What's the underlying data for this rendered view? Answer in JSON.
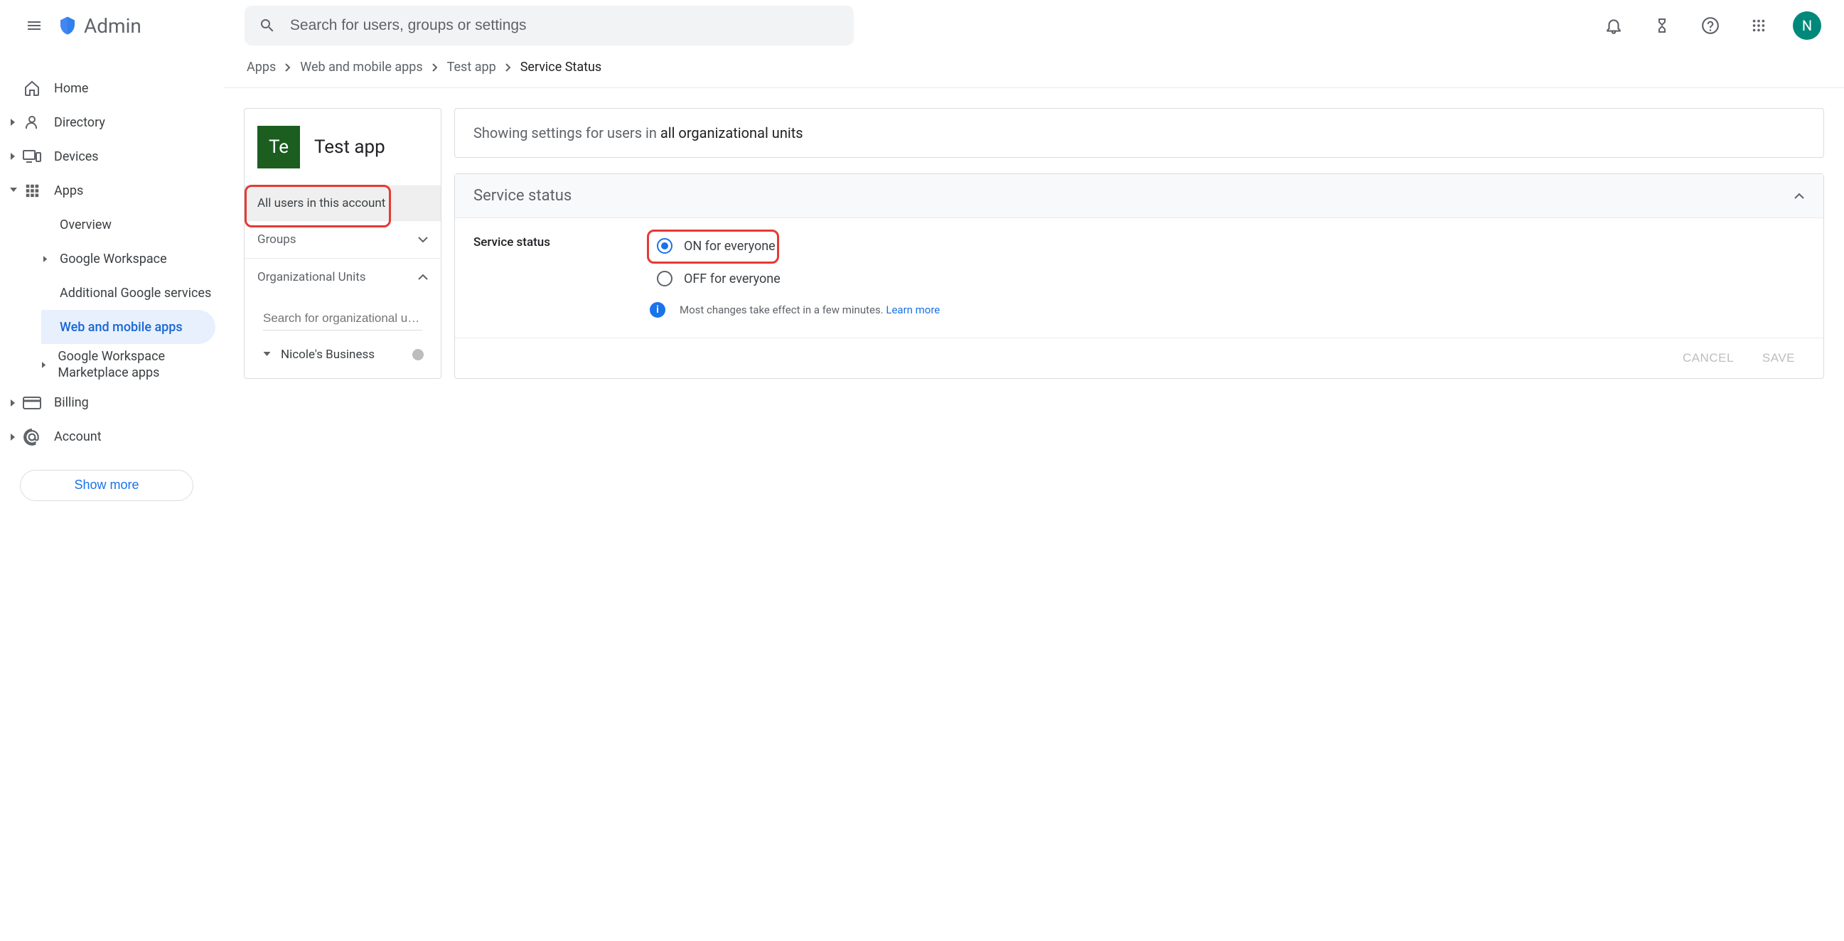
{
  "header": {
    "logo_text": "Admin",
    "search_placeholder": "Search for users, groups or settings",
    "avatar_letter": "N"
  },
  "sidebar": {
    "home": "Home",
    "directory": "Directory",
    "devices": "Devices",
    "apps": "Apps",
    "apps_sub": {
      "overview": "Overview",
      "google_workspace": "Google Workspace",
      "additional_services": "Additional Google services",
      "web_mobile": "Web and mobile apps",
      "marketplace": "Google Workspace Marketplace apps"
    },
    "billing": "Billing",
    "account": "Account",
    "show_more": "Show more"
  },
  "breadcrumb": {
    "apps": "Apps",
    "web_mobile": "Web and mobile apps",
    "test_app": "Test app",
    "service_status": "Service Status"
  },
  "left_panel": {
    "app_icon_text": "Te",
    "app_title": "Test app",
    "all_users": "All users in this account",
    "groups": "Groups",
    "org_units": "Organizational Units",
    "ou_search_placeholder": "Search for organizational uni…",
    "ou_root": "Nicole's Business"
  },
  "right_panel": {
    "scope_prefix": "Showing settings for users in ",
    "scope_bold": "all organizational units",
    "card_title": "Service status",
    "setting_label": "Service status",
    "radio_on": "ON for everyone",
    "radio_off": "OFF for everyone",
    "info_text": "Most changes take effect in a few minutes. ",
    "learn_more": "Learn more",
    "cancel": "CANCEL",
    "save": "SAVE"
  }
}
